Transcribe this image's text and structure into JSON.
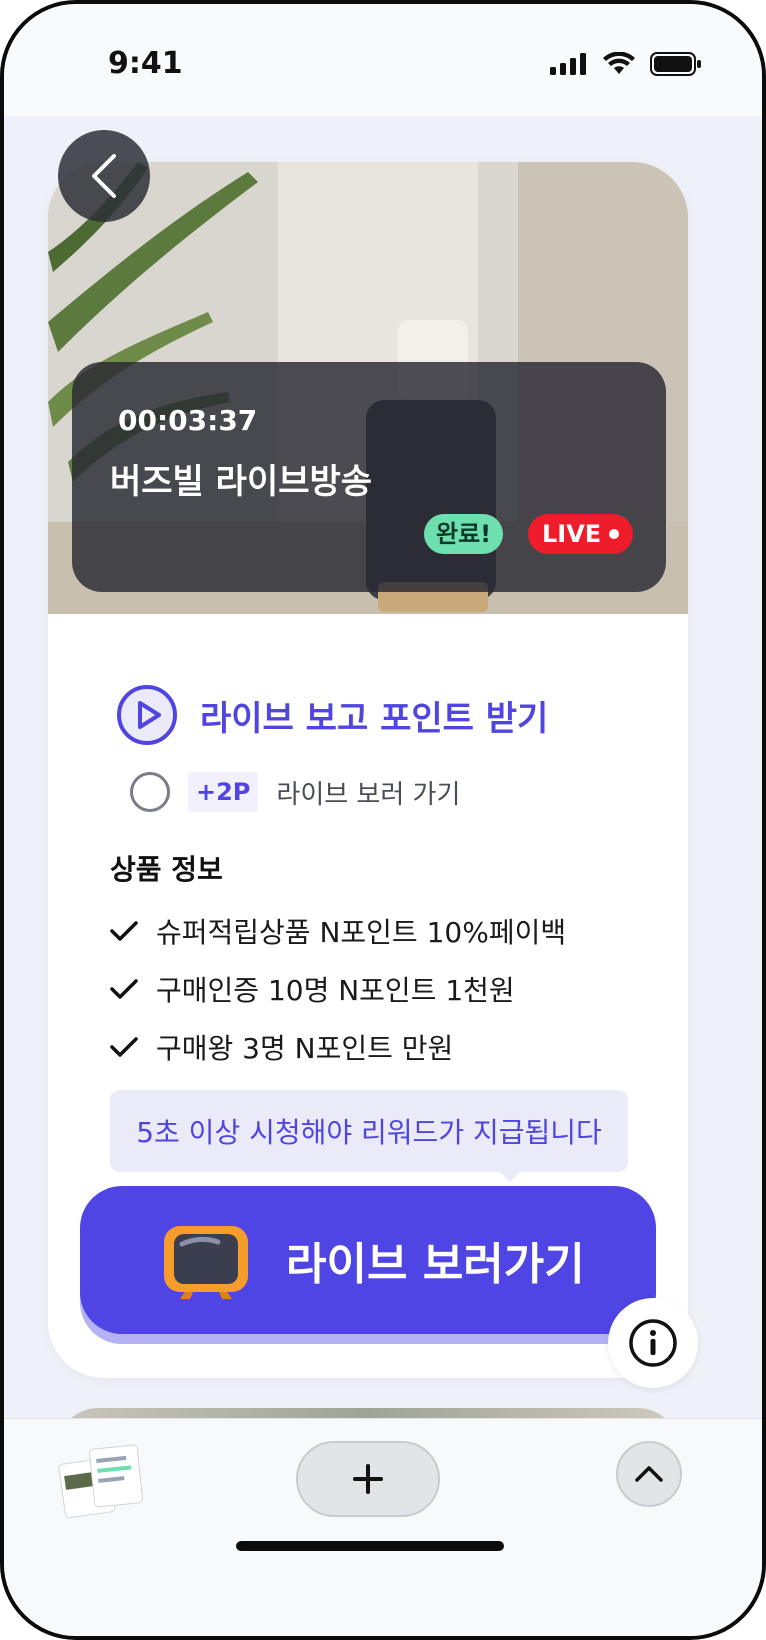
{
  "status_bar": {
    "time": "9:41"
  },
  "hero": {
    "timer": "00:03:37",
    "title": "버즈빌 라이브방송",
    "badge_done": "완료!",
    "badge_live": "LIVE"
  },
  "mission": {
    "title": "라이브 보고 포인트 받기",
    "points": "+2P",
    "task_label": "라이브 보러 가기"
  },
  "product_info": {
    "title": "상품 정보",
    "items": [
      "슈퍼적립상품 N포인트 10%페이백",
      "구매인증 10명 N포인트 1천원",
      "구매왕 3명 N포인트 만원"
    ]
  },
  "tooltip": "5초 이상 시청해야 리워드가 지급됩니다",
  "cta": {
    "label": "라이브 보러가기"
  },
  "colors": {
    "accent": "#4f45e4",
    "live_red": "#ef1d2b",
    "done_green": "#6ee0b0",
    "tooltip_bg": "#ebeaf9"
  },
  "icons": {
    "back": "chevron-left-icon",
    "play": "play-circle-icon",
    "check": "check-icon",
    "tv": "tv-icon",
    "info": "info-icon",
    "plus": "plus-icon",
    "up": "chevron-up-icon"
  }
}
